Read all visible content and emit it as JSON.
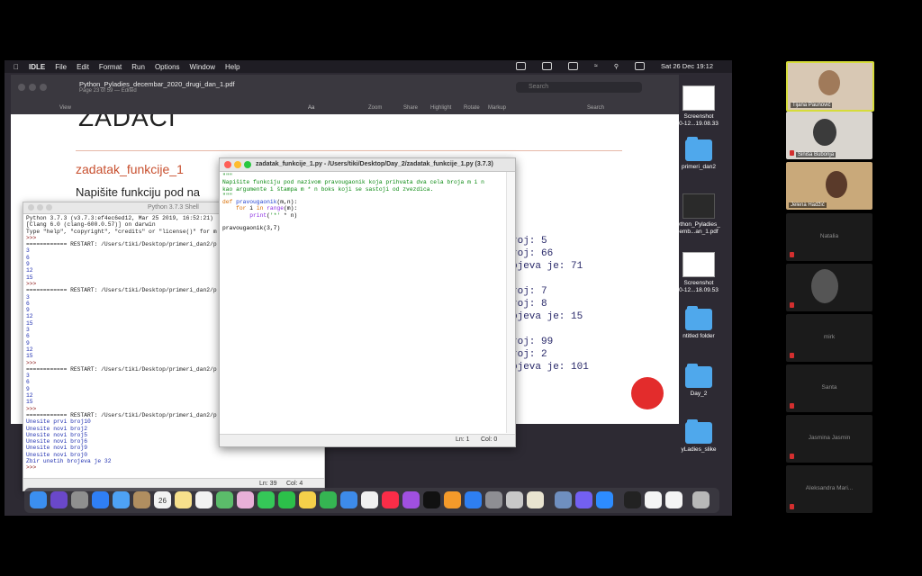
{
  "menubar": {
    "app": "IDLE",
    "items": [
      "File",
      "Edit",
      "Format",
      "Run",
      "Options",
      "Window",
      "Help"
    ],
    "clock": "Sat 26 Dec  19:12"
  },
  "preview": {
    "title": "Python_Pyladies_decembar_2020_drugi_dan_1.pdf",
    "subtitle": "Page 23 of 59 — Edited",
    "toolbar": [
      "View",
      "Zoom",
      "Share",
      "Highlight",
      "Rotate",
      "Markup",
      "Search"
    ],
    "search_placeholder": "Search",
    "aa_label": "Aa",
    "slide_heading": "ZADACI",
    "slide_title": "zadatak_funkcije_1",
    "slide_text": "Napišite funkciju pod na",
    "outline_lines": [
      "roj: 5",
      "roj: 66",
      "ojeva je: 71",
      "",
      "roj: 7",
      "roj: 8",
      "ojeva je: 15",
      "",
      "roj: 99",
      "roj: 2",
      "ojeva je: 101"
    ]
  },
  "desktop": {
    "items": [
      {
        "label": "Screenshot\n0-12...19.08.33",
        "kind": "thumb"
      },
      {
        "label": "primeri_dan2",
        "kind": "folder"
      },
      {
        "label": "ython_Pyladies_\nemb...an_1.pdf",
        "kind": "thumb"
      },
      {
        "label": "Screenshot\n0-12...18.09.53",
        "kind": "thumb"
      },
      {
        "label": "ntitled folder",
        "kind": "folder"
      },
      {
        "label": "Day_2",
        "kind": "folder"
      },
      {
        "label": "yLadies_slike",
        "kind": "folder"
      }
    ]
  },
  "shell": {
    "title": "Python 3.7.3 Shell",
    "status": {
      "ln": "Ln: 39",
      "col": "Col: 4"
    },
    "lines": [
      {
        "t": "Python 3.7.3 (v3.7.3:ef4ec6ed12, Mar 25 2019, 16:52:21)",
        "c": "restart"
      },
      {
        "t": "[Clang 6.0 (clang-600.0.57)] on darwin",
        "c": "restart"
      },
      {
        "t": "Type \"help\", \"copyright\", \"credits\" or \"license()\" for m",
        "c": "restart"
      },
      {
        "t": ">>>",
        "c": "prompt"
      },
      {
        "t": "============ RESTART: /Users/tiki/Desktop/primeri_dan2/p",
        "c": "restart"
      },
      {
        "t": "3",
        "c": "out"
      },
      {
        "t": "6",
        "c": "out"
      },
      {
        "t": "9",
        "c": "out"
      },
      {
        "t": "12",
        "c": "out"
      },
      {
        "t": "15",
        "c": "out"
      },
      {
        "t": ">>>",
        "c": "prompt"
      },
      {
        "t": "============ RESTART: /Users/tiki/Desktop/primeri_dan2/p",
        "c": "restart"
      },
      {
        "t": "3",
        "c": "out"
      },
      {
        "t": "6",
        "c": "out"
      },
      {
        "t": "9",
        "c": "out"
      },
      {
        "t": "12",
        "c": "out"
      },
      {
        "t": "15",
        "c": "out"
      },
      {
        "t": "3",
        "c": "out"
      },
      {
        "t": "6",
        "c": "out"
      },
      {
        "t": "9",
        "c": "out"
      },
      {
        "t": "12",
        "c": "out"
      },
      {
        "t": "15",
        "c": "out"
      },
      {
        "t": ">>>",
        "c": "prompt"
      },
      {
        "t": "============ RESTART: /Users/tiki/Desktop/primeri_dan2/p",
        "c": "restart"
      },
      {
        "t": "3",
        "c": "out"
      },
      {
        "t": "6",
        "c": "out"
      },
      {
        "t": "9",
        "c": "out"
      },
      {
        "t": "12",
        "c": "out"
      },
      {
        "t": "15",
        "c": "out"
      },
      {
        "t": ">>>",
        "c": "prompt"
      },
      {
        "t": "============ RESTART: /Users/tiki/Desktop/primeri_dan2/p",
        "c": "restart"
      },
      {
        "t": "Unesite prvi broj10",
        "c": "out"
      },
      {
        "t": "Unesite novi broj2",
        "c": "out"
      },
      {
        "t": "Unesite novi broj5",
        "c": "out"
      },
      {
        "t": "Unesite novi broj6",
        "c": "out"
      },
      {
        "t": "Unesite novi broj9",
        "c": "out"
      },
      {
        "t": "Unesite novi broj0",
        "c": "out"
      },
      {
        "t": "Zbir unetih brojeva je 32",
        "c": "out"
      },
      {
        "t": ">>>",
        "c": "prompt"
      }
    ]
  },
  "editor": {
    "title": "zadatak_funkcije_1.py - /Users/tiki/Desktop/Day_2/zadatak_funkcije_1.py (3.7.3)",
    "status": {
      "ln": "Ln: 1",
      "col": "Col: 0"
    },
    "code": [
      {
        "t": "\"\"\"",
        "c": "com"
      },
      {
        "t": "Napišite funkciju pod nazivom pravougaonik koja prihvata dva cela broja m i n",
        "c": "com"
      },
      {
        "t": "kao argumente i štampa m * n boks koji se sastoji od zvezdica.",
        "c": "com"
      },
      {
        "t": "\"\"\"",
        "c": "com"
      },
      {
        "t": "def pravougaonik(m,n):",
        "c": "def"
      },
      {
        "t": "    for i in range(m):",
        "c": "for"
      },
      {
        "t": "        print('*' * n)",
        "c": "print"
      },
      {
        "t": "",
        "c": "plain"
      },
      {
        "t": "pravougaonik(3,7)",
        "c": "plain"
      }
    ]
  },
  "participants": [
    {
      "name": "Tijana Paunović",
      "video": true
    },
    {
      "name": "Siniša Bubonja",
      "video": true
    },
    {
      "name": "Jelena Hadžić",
      "video": true
    },
    {
      "name": "Natalia",
      "video": false
    },
    {
      "name": "",
      "video": false
    },
    {
      "name": "mirk",
      "video": false
    },
    {
      "name": "Santa",
      "video": false
    },
    {
      "name": "Jasmina Jasmin",
      "video": false
    },
    {
      "name": "Aleksandra Mari...",
      "video": false
    }
  ]
}
